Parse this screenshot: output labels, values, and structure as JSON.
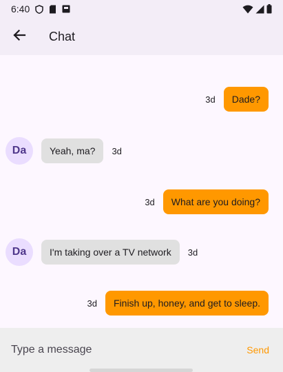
{
  "status_bar": {
    "time": "6:40",
    "icons": [
      "shield-icon",
      "sd-card-icon",
      "notification-box-icon",
      "wifi-icon",
      "signal-icon",
      "battery-icon"
    ]
  },
  "app_bar": {
    "title": "Chat",
    "back_icon": "arrow-back-icon"
  },
  "colors": {
    "outgoing_bubble": "#ff9800",
    "incoming_bubble": "#e0e0e0",
    "avatar_bg": "#eaddff",
    "send_text": "#ff9800"
  },
  "messages": [
    {
      "direction": "out",
      "text": "Dade?",
      "time": "3d"
    },
    {
      "direction": "in",
      "avatar": "Da",
      "text": "Yeah, ma?",
      "time": "3d"
    },
    {
      "direction": "out",
      "text": "What are you doing?",
      "time": "3d"
    },
    {
      "direction": "in",
      "avatar": "Da",
      "text": "I'm taking over a TV network",
      "time": "3d"
    },
    {
      "direction": "out",
      "text": "Finish up, honey, and get to sleep.",
      "time": "3d"
    }
  ],
  "composer": {
    "placeholder": "Type a message",
    "value": "",
    "send_label": "Send"
  }
}
